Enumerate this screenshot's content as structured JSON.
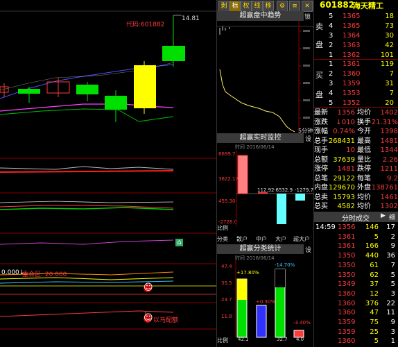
{
  "stock": {
    "code": "601882",
    "name": "海天精工"
  },
  "toolbar": {
    "buttons": [
      "剥",
      "标",
      "权",
      "线",
      "移",
      "⚙",
      "≡",
      "✕"
    ]
  },
  "chart": {
    "code_label": "代码:601882",
    "high_price": "14.81",
    "sub_label": "0.000↓",
    "sub_label2": "重合区: 20.000",
    "face_marker": "☺",
    "sub_label3": "以马配额",
    "house_icon": "⌂"
  },
  "trend_panel": {
    "title": "超赢盘中趋势",
    "side_label": "锁",
    "footer": "5分钟",
    "info_icon": "设"
  },
  "monitor_panel": {
    "title": "超赢实时监控",
    "date_label": "时间 2016/06/14",
    "info_icon": "设",
    "ticks": [
      "6699.7",
      "3622.17",
      "455.30",
      "-2726.0"
    ],
    "bar_labels": [
      "112.92",
      "-6532.9",
      "-1279.7"
    ],
    "footer_left": "比例",
    "categories_label": "分类",
    "categories": [
      "散户",
      "中户",
      "大户",
      "超大户"
    ]
  },
  "classify_panel": {
    "title": "超赢分类统计",
    "date_label": "时间 2016/06/14",
    "info_icon": "设",
    "ticks": [
      "47.4",
      "35.5",
      "23.7",
      "11.8"
    ],
    "pct_labels": [
      "+17.80%",
      "+0.30%",
      "-14.70%",
      "-3.40%"
    ],
    "bottom_values": [
      "42.1",
      "",
      "32.7",
      "4.0"
    ],
    "footer_left": "比例"
  },
  "orderbook": {
    "sell_label_top": "卖",
    "sell_label_bot": "盘",
    "buy_label_top": "买",
    "buy_label_bot": "盘",
    "sell": [
      {
        "level": "5",
        "price": "1365",
        "vol": "18"
      },
      {
        "level": "4",
        "price": "1365",
        "vol": "73"
      },
      {
        "level": "3",
        "price": "1364",
        "vol": "30"
      },
      {
        "level": "2",
        "price": "1363",
        "vol": "42"
      },
      {
        "level": "1",
        "price": "1362",
        "vol": "101"
      }
    ],
    "buy": [
      {
        "level": "1",
        "price": "1361",
        "vol": "119"
      },
      {
        "level": "2",
        "price": "1360",
        "vol": "7"
      },
      {
        "level": "3",
        "price": "1359",
        "vol": "31"
      },
      {
        "level": "4",
        "price": "1353",
        "vol": "7"
      },
      {
        "level": "5",
        "price": "1352",
        "vol": "20"
      }
    ]
  },
  "quote": [
    {
      "k1": "最新",
      "v1": "1356",
      "k2": "均价",
      "v2": "1402"
    },
    {
      "k1": "涨跌",
      "v1": "↓010",
      "k2": "换手",
      "v2": "21.31%"
    },
    {
      "k1": "涨幅",
      "v1": "0.74%",
      "k2": "今开",
      "v2": "1398"
    },
    {
      "k1": "总手",
      "v1": "268431",
      "k2": "最高",
      "v2": "1481"
    },
    {
      "k1": "现手",
      "v1": "10",
      "k2": "最低",
      "v2": "1344"
    },
    {
      "k1": "总额",
      "v1": "37639",
      "k2": "量比",
      "v2": "2.26"
    },
    {
      "k1": "涨停",
      "v1": "1481",
      "k2": "跌停",
      "v2": "1211"
    },
    {
      "k1": "总笔",
      "v1": "29122",
      "k2": "每笔",
      "v2": "9.2"
    },
    {
      "k1": "内盘",
      "v1": "129670",
      "k2": "外盘",
      "v2": "138761"
    },
    {
      "k1": "总卖",
      "v1": "15793",
      "k2": "均价",
      "v2": "1461"
    },
    {
      "k1": "总买",
      "v1": "4582",
      "k2": "均价",
      "v2": "1302"
    }
  ],
  "trades_panel": {
    "title": "分时成交",
    "detail_label": "细",
    "arrow": "▶"
  },
  "trades": [
    {
      "time": "14:59",
      "price": "1356",
      "vol": "146",
      "n": "17"
    },
    {
      "time": "",
      "price": "1361",
      "vol": "5",
      "n": "2"
    },
    {
      "time": "",
      "price": "1361",
      "vol": "166",
      "n": "9"
    },
    {
      "time": "",
      "price": "1350",
      "vol": "440",
      "n": "36"
    },
    {
      "time": "",
      "price": "1350",
      "vol": "61",
      "n": "7"
    },
    {
      "time": "",
      "price": "1350",
      "vol": "62",
      "n": "5"
    },
    {
      "time": "",
      "price": "1349",
      "vol": "37",
      "n": "5"
    },
    {
      "time": "",
      "price": "1360",
      "vol": "12",
      "n": "3"
    },
    {
      "time": "",
      "price": "1360",
      "vol": "376",
      "n": "22"
    },
    {
      "time": "",
      "price": "1360",
      "vol": "47",
      "n": "11"
    },
    {
      "time": "",
      "price": "1359",
      "vol": "75",
      "n": "9"
    },
    {
      "time": "",
      "price": "1359",
      "vol": "25",
      "n": "3"
    },
    {
      "time": "",
      "price": "1360",
      "vol": "5",
      "n": "1"
    }
  ]
}
